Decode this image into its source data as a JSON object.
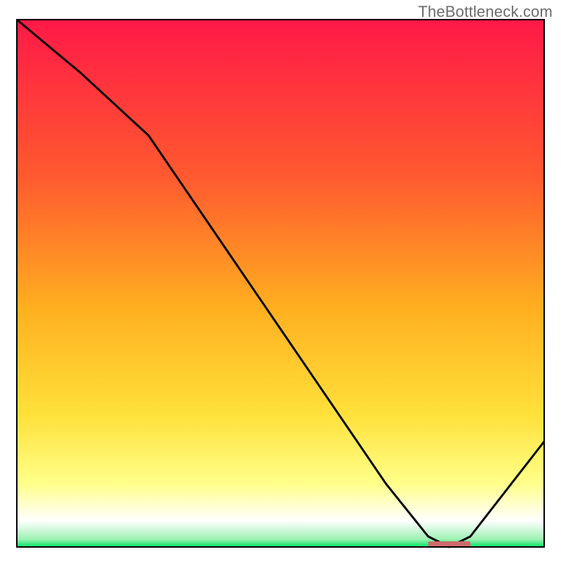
{
  "watermark": "TheBottleneck.com",
  "chart_data": {
    "type": "line",
    "title": "",
    "xlabel": "",
    "ylabel": "",
    "xlim": [
      0,
      100
    ],
    "ylim": [
      0,
      100
    ],
    "grid": false,
    "legend": false,
    "gradient_stops": [
      {
        "offset": 0,
        "color": "#ff1947"
      },
      {
        "offset": 0.3,
        "color": "#ff5a2f"
      },
      {
        "offset": 0.55,
        "color": "#ffb01f"
      },
      {
        "offset": 0.75,
        "color": "#ffe13a"
      },
      {
        "offset": 0.88,
        "color": "#ffff8a"
      },
      {
        "offset": 0.95,
        "color": "#ffffff"
      },
      {
        "offset": 0.985,
        "color": "#9ff2b3"
      },
      {
        "offset": 1.0,
        "color": "#00e765"
      }
    ],
    "series": [
      {
        "name": "bottleneck-curve",
        "color": "#000000",
        "x": [
          0,
          12,
          25,
          40,
          55,
          70,
          78,
          82,
          86,
          100
        ],
        "y": [
          100,
          90,
          78,
          56,
          34,
          12,
          2,
          0,
          2,
          20
        ]
      }
    ],
    "plateau_marker": {
      "name": "optimal-range",
      "x_start": 78,
      "x_end": 86,
      "y": 0,
      "color": "#d06a6a"
    }
  }
}
